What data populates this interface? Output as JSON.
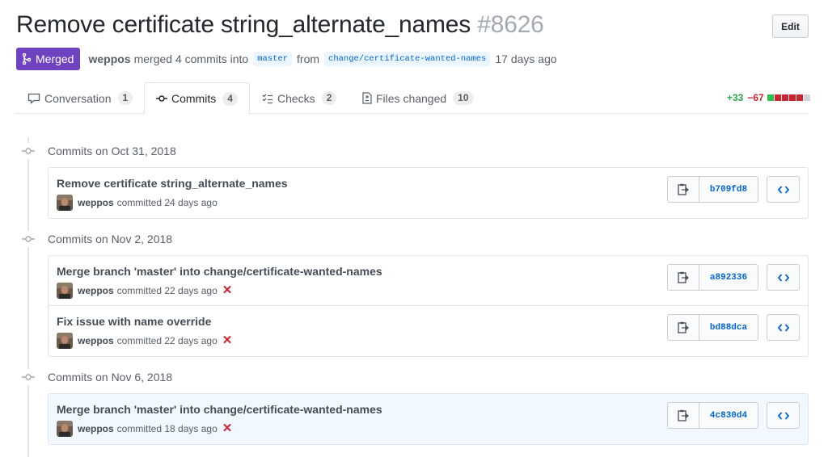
{
  "pr": {
    "title": "Remove certificate string_alternate_names",
    "number": "#8626",
    "edit_label": "Edit",
    "state": "Merged",
    "author": "weppos",
    "merge_text": "merged 4 commits into",
    "base_branch": "master",
    "from_text": "from",
    "head_branch": "change/certificate-wanted-names",
    "time_ago": "17 days ago"
  },
  "tabs": [
    {
      "label": "Conversation",
      "count": "1",
      "icon": "comment-icon",
      "selected": false
    },
    {
      "label": "Commits",
      "count": "4",
      "icon": "commit-icon",
      "selected": true
    },
    {
      "label": "Checks",
      "count": "2",
      "icon": "checks-icon",
      "selected": false
    },
    {
      "label": "Files changed",
      "count": "10",
      "icon": "file-diff-icon",
      "selected": false
    }
  ],
  "diffstat": {
    "additions": "+33",
    "deletions": "−67",
    "blocks": [
      "green",
      "red",
      "red",
      "red",
      "red",
      "gray"
    ]
  },
  "groups": [
    {
      "date": "Commits on Oct 31, 2018",
      "commits": [
        {
          "message": "Remove certificate string_alternate_names",
          "author": "weppos",
          "verb": "committed",
          "time": "24 days ago",
          "failed": false,
          "sha": "b709fd8",
          "highlight": false
        }
      ]
    },
    {
      "date": "Commits on Nov 2, 2018",
      "commits": [
        {
          "message": "Merge branch 'master' into change/certificate-wanted-names",
          "author": "weppos",
          "verb": "committed",
          "time": "22 days ago",
          "failed": true,
          "sha": "a892336",
          "highlight": false
        },
        {
          "message": "Fix issue with name override",
          "author": "weppos",
          "verb": "committed",
          "time": "22 days ago",
          "failed": true,
          "sha": "bd88dca",
          "highlight": false
        }
      ]
    },
    {
      "date": "Commits on Nov 6, 2018",
      "commits": [
        {
          "message": "Merge branch 'master' into change/certificate-wanted-names",
          "author": "weppos",
          "verb": "committed",
          "time": "18 days ago",
          "failed": true,
          "sha": "4c830d4",
          "highlight": true
        }
      ]
    }
  ],
  "colors": {
    "merged": "#6f42c1",
    "link": "#0366d6",
    "add": "#28a745",
    "del": "#cb2431"
  }
}
